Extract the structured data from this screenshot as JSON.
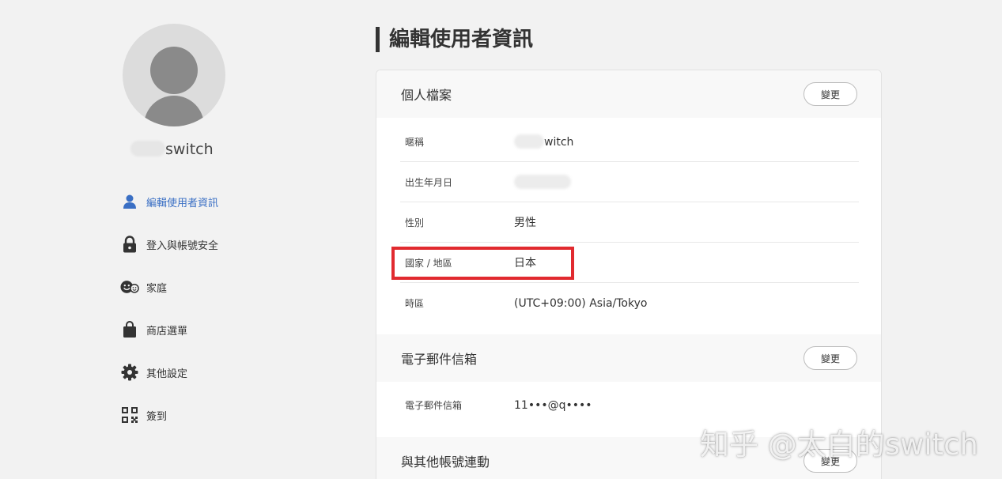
{
  "user": {
    "display_name": "switch"
  },
  "sidebar": {
    "items": [
      {
        "label": "編輯使用者資訊",
        "icon": "person-icon",
        "active": true
      },
      {
        "label": "登入與帳號安全",
        "icon": "lock-icon",
        "active": false
      },
      {
        "label": "家庭",
        "icon": "family-icon",
        "active": false
      },
      {
        "label": "商店選單",
        "icon": "shopping-bag-icon",
        "active": false
      },
      {
        "label": "其他設定",
        "icon": "gear-icon",
        "active": false
      },
      {
        "label": "簽到",
        "icon": "qr-code-icon",
        "active": false
      }
    ]
  },
  "main": {
    "title": "編輯使用者資訊",
    "profile": {
      "title": "個人檔案",
      "change_label": "變更",
      "rows": [
        {
          "label": "暱稱",
          "value": "witch"
        },
        {
          "label": "出生年月日",
          "value": ""
        },
        {
          "label": "性別",
          "value": "男性"
        },
        {
          "label": "國家 / 地區",
          "value": "日本"
        },
        {
          "label": "時區",
          "value": "(UTC+09:00) Asia/Tokyo"
        }
      ]
    },
    "email": {
      "title": "電子郵件信箱",
      "change_label": "變更",
      "rows": [
        {
          "label": "電子郵件信箱",
          "value": "11•••@q••••"
        }
      ]
    },
    "linked": {
      "title": "與其他帳號連動",
      "change_label": "變更"
    }
  },
  "watermark": "知乎 @太白的switch",
  "colors": {
    "accent": "#3a6fc4",
    "highlight": "#e12a2f",
    "background": "#f2f2f2"
  }
}
